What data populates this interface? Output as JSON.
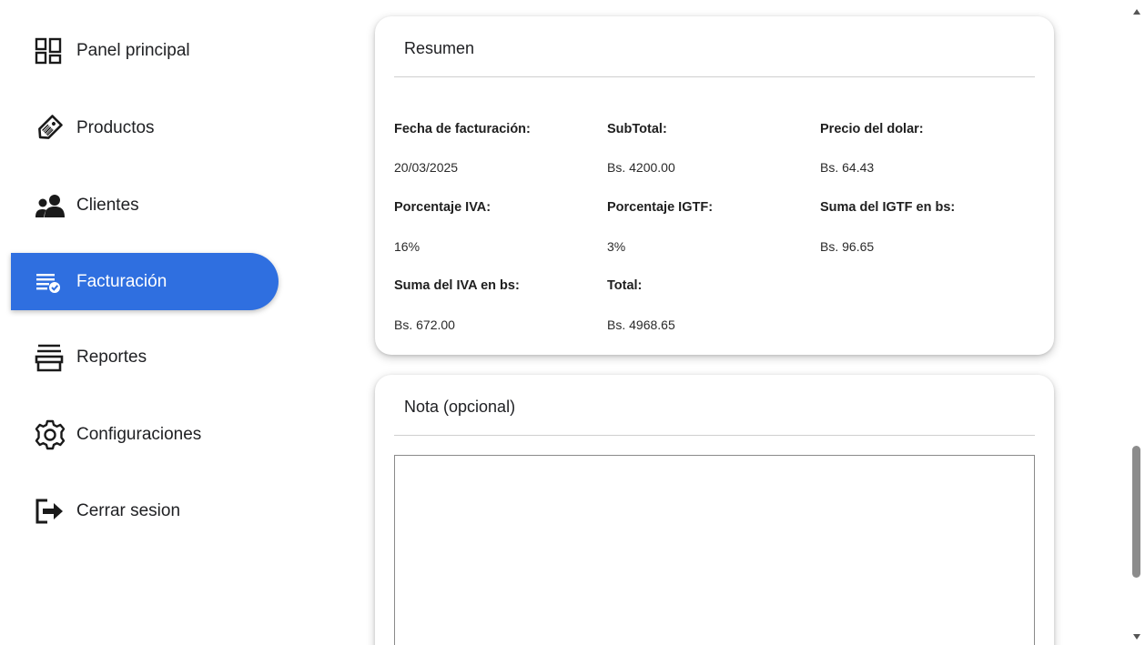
{
  "sidebar": {
    "items": [
      {
        "label": "Panel principal",
        "icon": "dashboard-icon"
      },
      {
        "label": "Productos",
        "icon": "tag-icon"
      },
      {
        "label": "Clientes",
        "icon": "people-icon"
      },
      {
        "label": "Facturación",
        "icon": "invoice-check-icon",
        "active": true
      },
      {
        "label": "Reportes",
        "icon": "reports-icon"
      },
      {
        "label": "Configuraciones",
        "icon": "gear-icon"
      },
      {
        "label": "Cerrar sesion",
        "icon": "logout-icon"
      }
    ]
  },
  "resumen": {
    "title": "Resumen",
    "fields": {
      "fecha_label": "Fecha de facturación:",
      "fecha_value": "20/03/2025",
      "subtotal_label": "SubTotal:",
      "subtotal_value": "Bs. 4200.00",
      "dolar_label": "Precio del dolar:",
      "dolar_value": "Bs. 64.43",
      "iva_pct_label": "Porcentaje IVA:",
      "iva_pct_value": "16%",
      "igtf_pct_label": "Porcentaje IGTF:",
      "igtf_pct_value": "3%",
      "igtf_sum_label": "Suma del IGTF en bs:",
      "igtf_sum_value": "Bs. 96.65",
      "iva_sum_label": "Suma del IVA en bs:",
      "iva_sum_value": "Bs. 672.00",
      "total_label": "Total:",
      "total_value": "Bs. 4968.65"
    }
  },
  "nota": {
    "title": "Nota (opcional)",
    "value": ""
  },
  "colors": {
    "accent": "#2f6fe0"
  }
}
